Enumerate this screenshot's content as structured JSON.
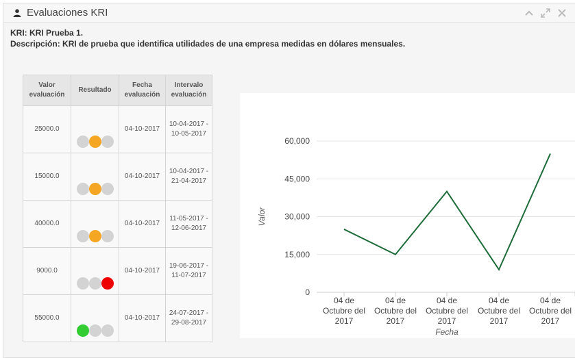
{
  "panel": {
    "title": "Evaluaciones KRI",
    "icons": [
      "user-icon",
      "chevron-up-icon",
      "expand-icon",
      "close-icon"
    ]
  },
  "kri": {
    "label": "KRI:",
    "name": "KRI Prueba 1",
    "desc_label": "Descripción:",
    "description": "KRI de prueba que identifica utilidades de una empresa medidas en dólares mensuales."
  },
  "table": {
    "headers": [
      "Valor evaluación",
      "Resultado",
      "Fecha evaluación",
      "Intervalo evaluación"
    ],
    "rows": [
      {
        "value": "25000.0",
        "date": "04-10-2017",
        "interval": "10-04-2017 - 10-05-2017",
        "lights": [
          "#d3d3d3",
          "#f5a623",
          "#d3d3d3"
        ]
      },
      {
        "value": "15000.0",
        "date": "04-10-2017",
        "interval": "10-04-2017 - 21-04-2017",
        "lights": [
          "#d3d3d3",
          "#f5a623",
          "#d3d3d3"
        ]
      },
      {
        "value": "40000.0",
        "date": "04-10-2017",
        "interval": "11-05-2017 - 12-06-2017",
        "lights": [
          "#d3d3d3",
          "#f5a623",
          "#d3d3d3"
        ]
      },
      {
        "value": "9000.0",
        "date": "04-10-2017",
        "interval": "19-06-2017 - 11-07-2017",
        "lights": [
          "#d3d3d3",
          "#d3d3d3",
          "#ee0000"
        ]
      },
      {
        "value": "55000.0",
        "date": "04-10-2017",
        "interval": "24-07-2017 - 29-08-2017",
        "lights": [
          "#33cc33",
          "#d3d3d3",
          "#d3d3d3"
        ]
      }
    ]
  },
  "chart_data": {
    "type": "line",
    "title": "",
    "xlabel": "Fecha",
    "ylabel": "Valor",
    "categories": [
      "04 de Octubre del 2017",
      "04 de Octubre del 2017",
      "04 de Octubre del 2017",
      "04 de Octubre del 2017",
      "04 de Octubre del 2017"
    ],
    "values": [
      25000,
      15000,
      40000,
      9000,
      55000
    ],
    "yticks": [
      "0",
      "15,000",
      "30,000",
      "45,000",
      "60,000"
    ],
    "ylim": [
      0,
      60000
    ],
    "grid": true,
    "line_color": "#1e6b3a"
  }
}
